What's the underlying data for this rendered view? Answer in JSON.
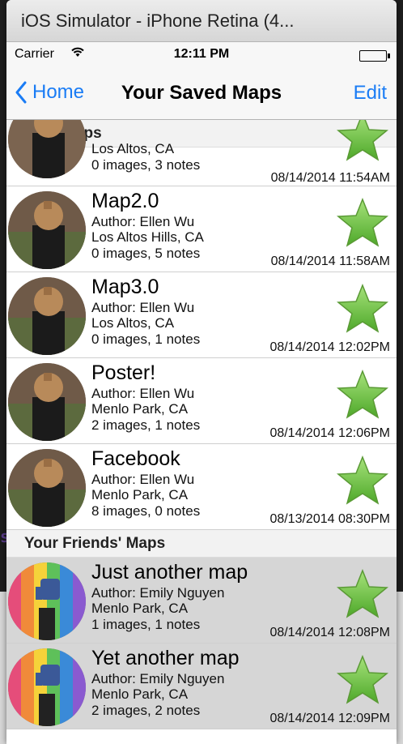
{
  "window": {
    "title": "iOS Simulator - iPhone Retina (4..."
  },
  "statusbar": {
    "carrier": "Carrier",
    "time": "12:11 PM"
  },
  "navbar": {
    "back_label": "Home",
    "title": "Your Saved Maps",
    "edit_label": "Edit"
  },
  "sections": [
    {
      "header": "Your Maps",
      "partial_row": {
        "location": "Los Altos, CA",
        "counts": "0 images, 3 notes",
        "date": "08/14/2014 11:54AM"
      },
      "rows": [
        {
          "title": "Map2.0",
          "author": "Author: Ellen Wu",
          "location": "Los Altos Hills, CA",
          "counts": "0 images, 5 notes",
          "date": "08/14/2014 11:58AM"
        },
        {
          "title": "Map3.0",
          "author": "Author: Ellen Wu",
          "location": "Los Altos, CA",
          "counts": "0 images, 1 notes",
          "date": "08/14/2014 12:02PM"
        },
        {
          "title": "Poster!",
          "author": "Author: Ellen Wu",
          "location": "Menlo Park, CA",
          "counts": "2 images, 1 notes",
          "date": "08/14/2014 12:06PM"
        },
        {
          "title": "Facebook",
          "author": "Author: Ellen Wu",
          "location": "Menlo Park, CA",
          "counts": "8 images, 0 notes",
          "date": "08/13/2014 08:30PM"
        }
      ]
    },
    {
      "header": "Your Friends' Maps",
      "rows": [
        {
          "title": "Just another map",
          "author": "Author: Emily Nguyen",
          "location": "Menlo Park, CA",
          "counts": "1 images, 1 notes",
          "date": "08/14/2014 12:08PM"
        },
        {
          "title": "Yet another map",
          "author": "Author: Emily Nguyen",
          "location": "Menlo Park, CA",
          "counts": "2 images, 2 notes",
          "date": "08/14/2014 12:09PM"
        }
      ]
    }
  ],
  "icons": {
    "back": "chevron-left-icon",
    "favorite": "star-icon",
    "wifi": "wifi-icon",
    "battery": "battery-icon"
  },
  "colors": {
    "accent": "#1a7cf5",
    "star": "#6cc53a"
  }
}
